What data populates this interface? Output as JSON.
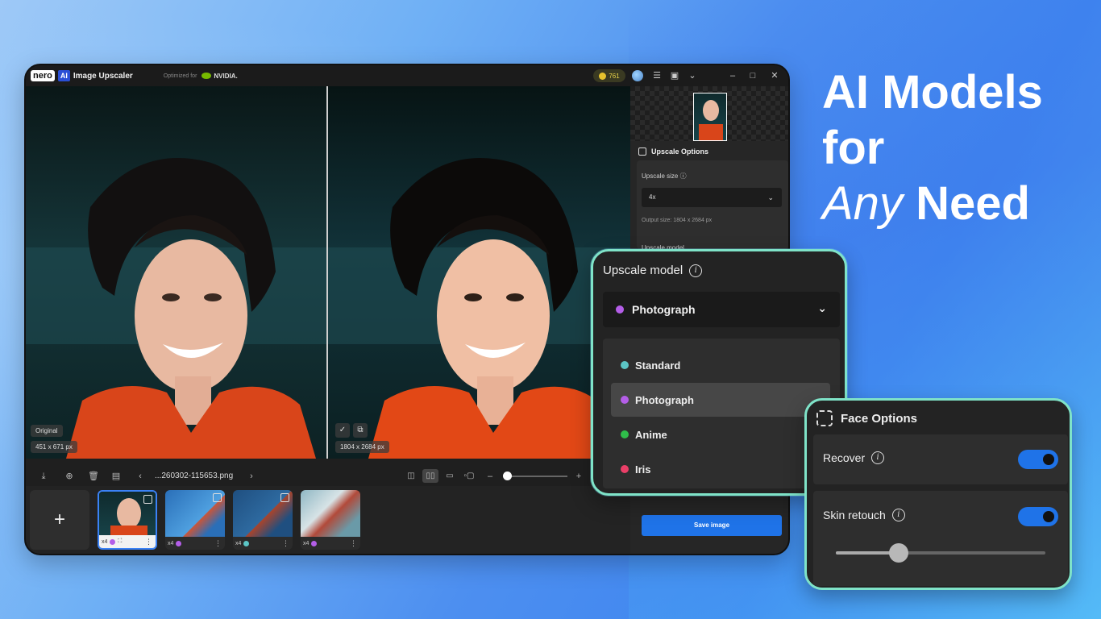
{
  "headline": {
    "line1": "AI Models",
    "line2": "for",
    "any": "Any",
    "need": "Need"
  },
  "app": {
    "brand": "nero",
    "ai_badge": "AI",
    "title": "Image Upscaler",
    "optimized_for": "Optimized for",
    "partner": "NVIDIA.",
    "credits": "761"
  },
  "canvas": {
    "left_tag": "Original",
    "left_size": "451 x 671 px",
    "right_size": "1804 x 2684 px"
  },
  "toolbar": {
    "filename": "...260302-115653.png",
    "prev_icon": "chevron-left-icon",
    "next_icon": "chevron-right-icon"
  },
  "thumbnails": [
    {
      "scale": "x4",
      "model_color": "#b45ee8",
      "selected": true
    },
    {
      "scale": "x4",
      "model_color": "#b45ee8",
      "selected": false
    },
    {
      "scale": "x4",
      "model_color": "#5cc6c6",
      "selected": false
    },
    {
      "scale": "x4",
      "model_color": "#b45ee8",
      "selected": false
    }
  ],
  "panel": {
    "section_title": "Upscale Options",
    "upscale_size_label": "Upscale size",
    "upscale_size_value": "4x",
    "output_size": "Output size: 1804 x 2684 px",
    "upscale_model_label": "Upscale model",
    "save_button": "Save image"
  },
  "model_card": {
    "title": "Upscale model",
    "selected": "Photograph",
    "selected_color": "#b45ee8",
    "options": [
      {
        "label": "Standard",
        "color": "#5cc6c6"
      },
      {
        "label": "Photograph",
        "color": "#b45ee8"
      },
      {
        "label": "Anime",
        "color": "#2fbd4a"
      },
      {
        "label": "Iris",
        "color": "#ea3f68"
      }
    ]
  },
  "face_card": {
    "title": "Face Options",
    "recover_label": "Recover",
    "recover_on": true,
    "skin_label": "Skin retouch",
    "skin_on": true,
    "skin_level": 0.3
  }
}
